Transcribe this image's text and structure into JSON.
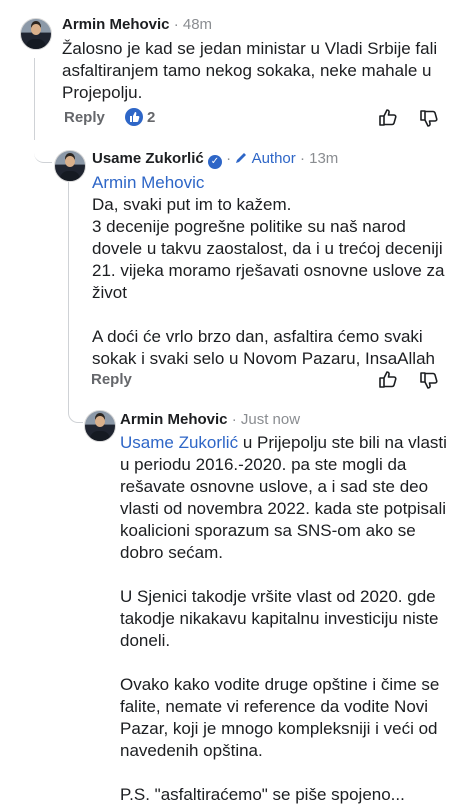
{
  "comments": [
    {
      "author": "Armin Mehovic",
      "time": "48m",
      "text_lines": [
        "Žalosno je kad se jedan ministar u Vladi Srbije fali",
        "asfaltiranjem tamo nekog sokaka, neke mahale u",
        "Projepolju."
      ],
      "reply_label": "Reply",
      "reaction_count": "2"
    },
    {
      "author": "Usame Zukorlić",
      "author_badge": "Author",
      "time": "13m",
      "mention": "Armin Mehovic",
      "text_lines": [
        "Da, svaki put im to kažem.",
        "3 decenije pogrešne politike su naš narod",
        "dovele u takvu zaostalost, da i u trećoj deceniji",
        "21. vijeka moramo rješavati osnovne uslove za",
        "život",
        "",
        "A doći će vrlo brzo dan, asfaltira ćemo svaki",
        "sokak i svaki selo u Novom Pazaru, InsaAllah"
      ],
      "reply_label": "Reply"
    },
    {
      "author": "Armin Mehovic",
      "time": "Just now",
      "mention": "Usame Zukorlić",
      "first_line_rest": " u Prijepolju ste bili na vlasti",
      "text_lines": [
        "u periodu 2016.-2020. pa ste mogli da",
        "rešavate osnovne uslove, a i sad ste deo",
        "vlasti od novembra 2022. kada ste potpisali",
        "koalicioni sporazum sa SNS-om ako se",
        "dobro sećam.",
        "",
        "U Sjenici takodje vršite vlast od 2020. gde",
        "takodje nikakavu kapitalnu investiciju niste",
        "doneli.",
        "",
        "Ovako kako vodite druge opštine i čime se",
        "falite, nemate vi reference da vodite Novi",
        "Pazar, koji je mnogo kompleksniji i veći od",
        "navedenih opština.",
        "",
        "P.S. \"asfaltiraćemo\" se piše spojeno..."
      ]
    }
  ],
  "separator": "·",
  "colors": {
    "link": "#2e66c7",
    "meta": "#8a8d91",
    "text": "#1c1e21"
  }
}
